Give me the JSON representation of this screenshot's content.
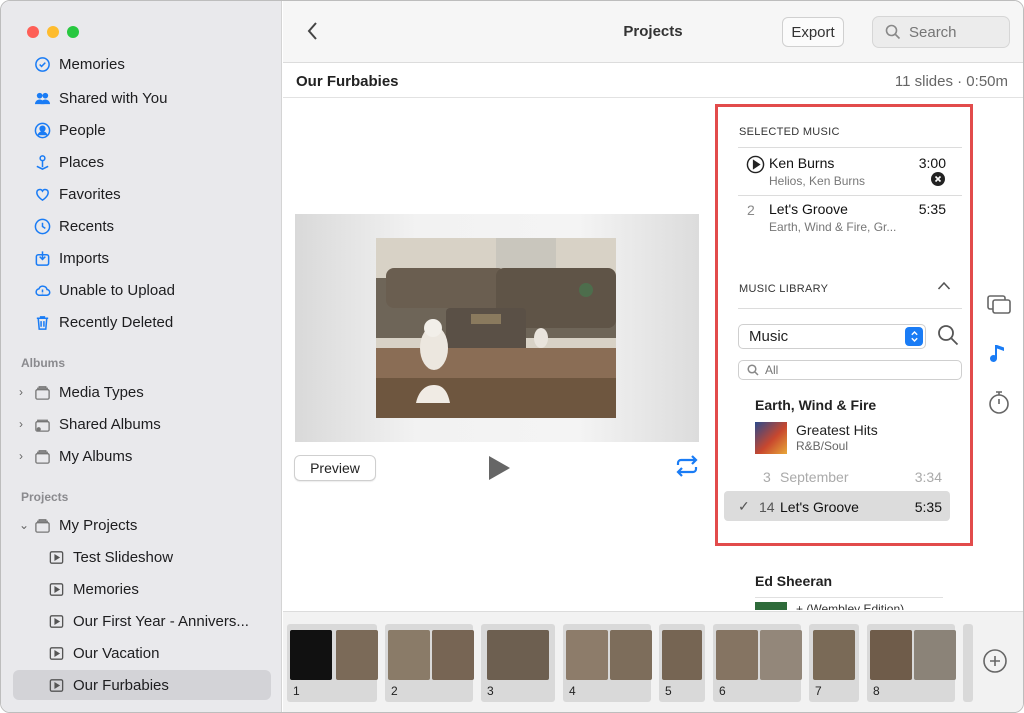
{
  "window": {
    "title": "Projects"
  },
  "sidebar": {
    "library_items": [
      {
        "label": "Memories",
        "icon": "memories-icon"
      },
      {
        "label": "Shared with You",
        "icon": "shared-with-you-icon"
      },
      {
        "label": "People",
        "icon": "people-icon"
      },
      {
        "label": "Places",
        "icon": "places-icon"
      },
      {
        "label": "Favorites",
        "icon": "heart-icon"
      },
      {
        "label": "Recents",
        "icon": "clock-icon"
      },
      {
        "label": "Imports",
        "icon": "import-icon"
      },
      {
        "label": "Unable to Upload",
        "icon": "cloud-icon"
      },
      {
        "label": "Recently Deleted",
        "icon": "trash-icon"
      }
    ],
    "albums_heading": "Albums",
    "albums": [
      {
        "label": "Media Types"
      },
      {
        "label": "Shared Albums"
      },
      {
        "label": "My Albums"
      }
    ],
    "projects_heading": "Projects",
    "my_projects": "My Projects",
    "projects": [
      {
        "label": "Test Slideshow"
      },
      {
        "label": "Memories"
      },
      {
        "label": "Our First Year - Annivers..."
      },
      {
        "label": "Our Vacation"
      },
      {
        "label": "Our Furbabies",
        "selected": true
      }
    ]
  },
  "toolbar": {
    "title": "Projects",
    "export_label": "Export",
    "search_placeholder": "Search"
  },
  "project": {
    "name": "Our Furbabies",
    "meta": "11 slides · 0:50m",
    "preview_label": "Preview"
  },
  "music": {
    "selected_heading": "SELECTED MUSIC",
    "selected": [
      {
        "index": "",
        "title": "Ken Burns",
        "artist": "Helios, Ken Burns",
        "time": "3:00"
      },
      {
        "index": "2",
        "title": "Let's Groove",
        "artist": "Earth, Wind & Fire, Gr...",
        "time": "5:35"
      }
    ],
    "library_heading": "MUSIC LIBRARY",
    "source": "Music",
    "filter_placeholder": "All",
    "artist": "Earth, Wind & Fire",
    "album_title": "Greatest Hits",
    "album_genre": "R&B/Soul",
    "tracks": [
      {
        "num": "3",
        "title": "September",
        "time": "3:34",
        "selected": false
      },
      {
        "num": "14",
        "title": "Let's Groove",
        "time": "5:35",
        "selected": true
      }
    ],
    "next_artist": "Ed Sheeran",
    "next_album_partial": "+ (Wembley Edition)"
  },
  "filmstrip": {
    "slides": [
      "1",
      "2",
      "3",
      "4",
      "5",
      "6",
      "7",
      "8"
    ]
  },
  "colors": {
    "accent": "#1a7cf5",
    "highlight_border": "#e24b4b",
    "sidebar_bg": "#e9e9ec"
  }
}
